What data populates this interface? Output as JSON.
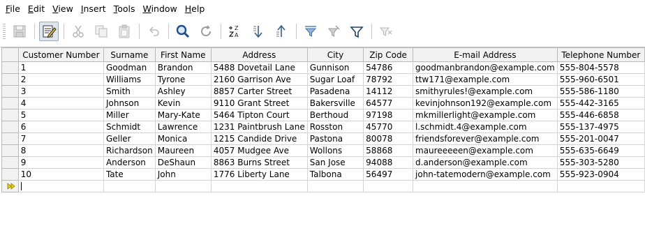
{
  "menubar": {
    "items": [
      {
        "label": "File",
        "underline": "F",
        "rest": "ile"
      },
      {
        "label": "Edit",
        "underline": "E",
        "rest": "dit"
      },
      {
        "label": "View",
        "underline": "V",
        "rest": "iew"
      },
      {
        "label": "Insert",
        "underline": "I",
        "rest": "nsert"
      },
      {
        "label": "Tools",
        "underline": "T",
        "rest": "ools"
      },
      {
        "label": "Window",
        "underline": "W",
        "rest": "indow"
      },
      {
        "label": "Help",
        "underline": "H",
        "rest": "elp"
      }
    ]
  },
  "toolbar": {
    "buttons": [
      {
        "icon": "save-icon",
        "enabled": false
      },
      {
        "icon": "edit-data-icon",
        "enabled": true,
        "active": true
      },
      {
        "icon": "cut-icon",
        "enabled": false
      },
      {
        "icon": "copy-icon",
        "enabled": false
      },
      {
        "icon": "paste-icon",
        "enabled": false
      },
      {
        "icon": "undo-icon",
        "enabled": false
      },
      {
        "icon": "find-record-icon",
        "enabled": true
      },
      {
        "icon": "refresh-icon",
        "enabled": true
      },
      {
        "icon": "sort-icon",
        "enabled": true
      },
      {
        "icon": "sort-ascending-icon",
        "enabled": true
      },
      {
        "icon": "sort-descending-icon",
        "enabled": true
      },
      {
        "icon": "autofilter-icon",
        "enabled": true
      },
      {
        "icon": "apply-filter-icon",
        "enabled": true
      },
      {
        "icon": "standard-filter-icon",
        "enabled": true
      },
      {
        "icon": "reset-filter-icon",
        "enabled": false
      }
    ]
  },
  "grid": {
    "columns": [
      "Customer Number",
      "Surname",
      "First Name",
      "Address",
      "City",
      "Zip Code",
      "E-mail Address",
      "Telephone Number"
    ],
    "rows": [
      [
        "1",
        "Goodman",
        "Brandon",
        "5488 Dovetail Lane",
        "Gunnison",
        "54786",
        "goodmanbrandon@example.com",
        "555-804-5578"
      ],
      [
        "2",
        "Williams",
        "Tyrone",
        "2160 Garrison Ave",
        "Sugar Loaf",
        "78792",
        "ttw171@example.com",
        "555-960-6501"
      ],
      [
        "3",
        "Smith",
        "Ashley",
        "8857 Carter Street",
        "Pasadena",
        "14112",
        "smithyrules!@example.com",
        "555-586-1180"
      ],
      [
        "4",
        "Johnson",
        "Kevin",
        "9110 Grant Street",
        "Bakersville",
        "64577",
        "kevinjohnson192@example.com",
        "555-442-3165"
      ],
      [
        "5",
        "Miller",
        "Mary-Kate",
        "5464 Tipton Court",
        "Berthoud",
        "97198",
        "mkmillerlight@example.com",
        "555-446-6858"
      ],
      [
        "6",
        "Schmidt",
        "Lawrence",
        "1231 Paintbrush Lane",
        "Rosston",
        "45770",
        "l.schmidt.4@example.com",
        "555-137-4975"
      ],
      [
        "7",
        "Geller",
        "Monica",
        "1215 Candide Drive",
        "Pastona",
        "80078",
        "friendsforever@example.com",
        "555-201-0047"
      ],
      [
        "8",
        "Richardson",
        "Maureen",
        "4057 Mudgee Ave",
        "Wollons",
        "58868",
        "maureeeeen@example.com",
        "555-635-6649"
      ],
      [
        "9",
        "Anderson",
        "DeShaun",
        "8863 Burns Street",
        "San Jose",
        "94088",
        "d.anderson@example.com",
        "555-303-5280"
      ],
      [
        "10",
        "Tate",
        "John",
        "1776 Liberty Lane",
        "Talbona",
        "56497",
        "john-tatemodern@example.com",
        "555-923-0904"
      ]
    ]
  },
  "colors": {
    "header_bg": "#f2f2f2",
    "grid_line": "#d3d3d3",
    "active_button_bg": "#dfe6ee",
    "new_row_marker": "#e6d200"
  }
}
